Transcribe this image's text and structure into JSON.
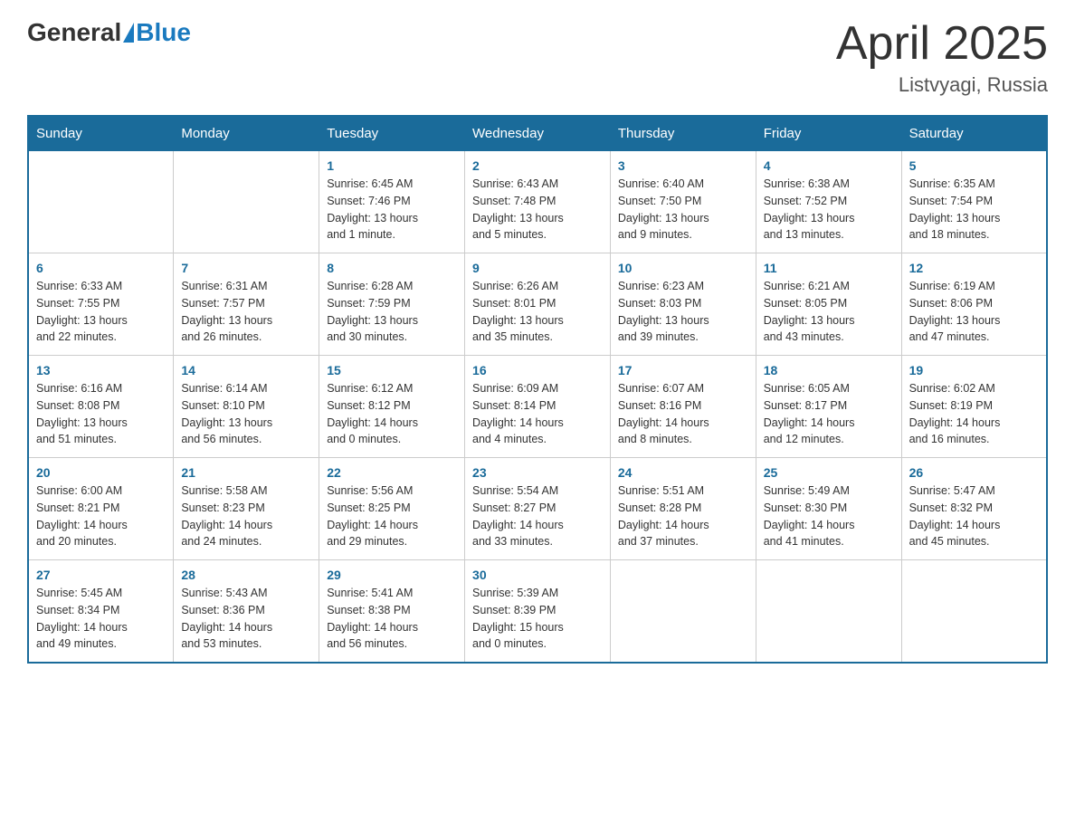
{
  "header": {
    "logo_text_general": "General",
    "logo_text_blue": "Blue",
    "month_title": "April 2025",
    "location": "Listvyagi, Russia"
  },
  "weekdays": [
    "Sunday",
    "Monday",
    "Tuesday",
    "Wednesday",
    "Thursday",
    "Friday",
    "Saturday"
  ],
  "weeks": [
    [
      {
        "day": "",
        "info": ""
      },
      {
        "day": "",
        "info": ""
      },
      {
        "day": "1",
        "info": "Sunrise: 6:45 AM\nSunset: 7:46 PM\nDaylight: 13 hours\nand 1 minute."
      },
      {
        "day": "2",
        "info": "Sunrise: 6:43 AM\nSunset: 7:48 PM\nDaylight: 13 hours\nand 5 minutes."
      },
      {
        "day": "3",
        "info": "Sunrise: 6:40 AM\nSunset: 7:50 PM\nDaylight: 13 hours\nand 9 minutes."
      },
      {
        "day": "4",
        "info": "Sunrise: 6:38 AM\nSunset: 7:52 PM\nDaylight: 13 hours\nand 13 minutes."
      },
      {
        "day": "5",
        "info": "Sunrise: 6:35 AM\nSunset: 7:54 PM\nDaylight: 13 hours\nand 18 minutes."
      }
    ],
    [
      {
        "day": "6",
        "info": "Sunrise: 6:33 AM\nSunset: 7:55 PM\nDaylight: 13 hours\nand 22 minutes."
      },
      {
        "day": "7",
        "info": "Sunrise: 6:31 AM\nSunset: 7:57 PM\nDaylight: 13 hours\nand 26 minutes."
      },
      {
        "day": "8",
        "info": "Sunrise: 6:28 AM\nSunset: 7:59 PM\nDaylight: 13 hours\nand 30 minutes."
      },
      {
        "day": "9",
        "info": "Sunrise: 6:26 AM\nSunset: 8:01 PM\nDaylight: 13 hours\nand 35 minutes."
      },
      {
        "day": "10",
        "info": "Sunrise: 6:23 AM\nSunset: 8:03 PM\nDaylight: 13 hours\nand 39 minutes."
      },
      {
        "day": "11",
        "info": "Sunrise: 6:21 AM\nSunset: 8:05 PM\nDaylight: 13 hours\nand 43 minutes."
      },
      {
        "day": "12",
        "info": "Sunrise: 6:19 AM\nSunset: 8:06 PM\nDaylight: 13 hours\nand 47 minutes."
      }
    ],
    [
      {
        "day": "13",
        "info": "Sunrise: 6:16 AM\nSunset: 8:08 PM\nDaylight: 13 hours\nand 51 minutes."
      },
      {
        "day": "14",
        "info": "Sunrise: 6:14 AM\nSunset: 8:10 PM\nDaylight: 13 hours\nand 56 minutes."
      },
      {
        "day": "15",
        "info": "Sunrise: 6:12 AM\nSunset: 8:12 PM\nDaylight: 14 hours\nand 0 minutes."
      },
      {
        "day": "16",
        "info": "Sunrise: 6:09 AM\nSunset: 8:14 PM\nDaylight: 14 hours\nand 4 minutes."
      },
      {
        "day": "17",
        "info": "Sunrise: 6:07 AM\nSunset: 8:16 PM\nDaylight: 14 hours\nand 8 minutes."
      },
      {
        "day": "18",
        "info": "Sunrise: 6:05 AM\nSunset: 8:17 PM\nDaylight: 14 hours\nand 12 minutes."
      },
      {
        "day": "19",
        "info": "Sunrise: 6:02 AM\nSunset: 8:19 PM\nDaylight: 14 hours\nand 16 minutes."
      }
    ],
    [
      {
        "day": "20",
        "info": "Sunrise: 6:00 AM\nSunset: 8:21 PM\nDaylight: 14 hours\nand 20 minutes."
      },
      {
        "day": "21",
        "info": "Sunrise: 5:58 AM\nSunset: 8:23 PM\nDaylight: 14 hours\nand 24 minutes."
      },
      {
        "day": "22",
        "info": "Sunrise: 5:56 AM\nSunset: 8:25 PM\nDaylight: 14 hours\nand 29 minutes."
      },
      {
        "day": "23",
        "info": "Sunrise: 5:54 AM\nSunset: 8:27 PM\nDaylight: 14 hours\nand 33 minutes."
      },
      {
        "day": "24",
        "info": "Sunrise: 5:51 AM\nSunset: 8:28 PM\nDaylight: 14 hours\nand 37 minutes."
      },
      {
        "day": "25",
        "info": "Sunrise: 5:49 AM\nSunset: 8:30 PM\nDaylight: 14 hours\nand 41 minutes."
      },
      {
        "day": "26",
        "info": "Sunrise: 5:47 AM\nSunset: 8:32 PM\nDaylight: 14 hours\nand 45 minutes."
      }
    ],
    [
      {
        "day": "27",
        "info": "Sunrise: 5:45 AM\nSunset: 8:34 PM\nDaylight: 14 hours\nand 49 minutes."
      },
      {
        "day": "28",
        "info": "Sunrise: 5:43 AM\nSunset: 8:36 PM\nDaylight: 14 hours\nand 53 minutes."
      },
      {
        "day": "29",
        "info": "Sunrise: 5:41 AM\nSunset: 8:38 PM\nDaylight: 14 hours\nand 56 minutes."
      },
      {
        "day": "30",
        "info": "Sunrise: 5:39 AM\nSunset: 8:39 PM\nDaylight: 15 hours\nand 0 minutes."
      },
      {
        "day": "",
        "info": ""
      },
      {
        "day": "",
        "info": ""
      },
      {
        "day": "",
        "info": ""
      }
    ]
  ]
}
